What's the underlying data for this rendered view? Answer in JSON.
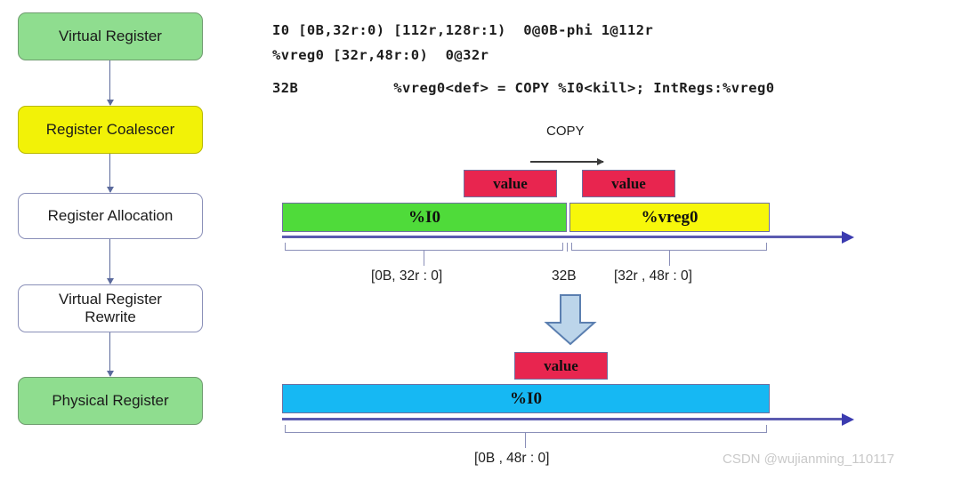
{
  "pipeline": {
    "steps": [
      {
        "label": "Virtual Register",
        "color": "green"
      },
      {
        "label": "Register Coalescer",
        "color": "yellow"
      },
      {
        "label": "Register Allocation",
        "color": "white"
      },
      {
        "label": "Virtual Register\nRewrite",
        "color": "white"
      },
      {
        "label": "Physical Register",
        "color": "green"
      }
    ]
  },
  "code": {
    "line1": "I0 [0B,32r:0) [112r,128r:1)  0@0B-phi 1@112r",
    "line2": "%vreg0 [32r,48r:0)  0@32r",
    "line3": "32B           %vreg0<def> = COPY %I0<kill>; IntRegs:%vreg0"
  },
  "before": {
    "copy_label": "COPY",
    "value_left": "value",
    "value_right": "value",
    "reg_left": "%I0",
    "reg_right": "%vreg0",
    "range_left": "[0B, 32r : 0]",
    "split_point": "32B",
    "range_right": "[32r , 48r : 0]"
  },
  "after": {
    "value": "value",
    "reg": "%I0",
    "range": "[0B , 48r : 0]"
  },
  "watermark": "CSDN @wujianming_110117",
  "colors": {
    "green_box": "#8fdd8f",
    "yellow_box": "#f2f207",
    "green_bar": "#4fdb3a",
    "yellow_bar": "#f7f70a",
    "cyan_bar": "#16b8f3",
    "value_red": "#e8254f",
    "timeline_blue": "#5b5bb0",
    "arrow_fill": "#bcd5ea"
  }
}
